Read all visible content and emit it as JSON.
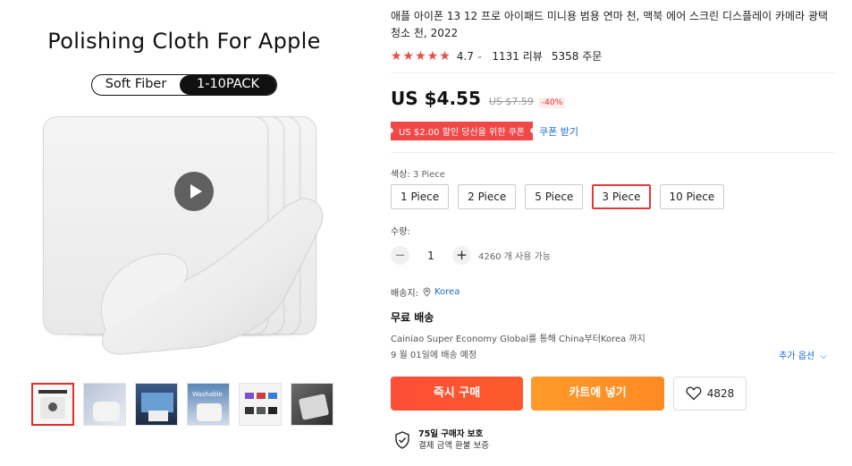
{
  "gallery": {
    "title": "Polishing Cloth For Apple",
    "pill_left": "Soft Fiber",
    "pill_right": "1-10PACK",
    "thumbs": [
      {
        "name": "thumb-1"
      },
      {
        "name": "thumb-2"
      },
      {
        "name": "thumb-3"
      },
      {
        "name": "thumb-4"
      },
      {
        "name": "thumb-5"
      },
      {
        "name": "thumb-6"
      }
    ],
    "thumb_4_text": "Washable"
  },
  "product": {
    "title": "애플 아이폰 13 12 프로 아이패드 미니용 범용 연마 천, 맥북 에어 스크린 디스플레이 카메라 광택 청소 천, 2022",
    "rating": "4.7",
    "rating_count": 5,
    "reviews": "1131 리뷰",
    "orders": "5358 주문",
    "price": "US $4.55",
    "old_price": "US $7.59",
    "discount": "-40%",
    "coupon": "US $2.00 할인 당신을 위한 쿠폰",
    "coupon_link": "쿠폰 받기"
  },
  "color": {
    "label": "색상:",
    "selected": "3 Piece",
    "options": [
      "1 Piece",
      "2 Piece",
      "5 Piece",
      "3 Piece",
      "10 Piece"
    ],
    "selected_index": 3
  },
  "quantity": {
    "label": "수량:",
    "minus": "−",
    "value": "1",
    "plus": "+",
    "available": "4260 개 사용 가능"
  },
  "shipping": {
    "to_label": "배송지:",
    "country": "Korea",
    "free": "무료 배송",
    "carrier": "Cainiao Super Economy Global를 통해 China부터Korea 까지",
    "eta": "9 월 01일에 배송 예정",
    "more": "추가 옵션"
  },
  "actions": {
    "buy": "즉시 구매",
    "cart": "카트에 넣기",
    "wish_count": "4828"
  },
  "protection": {
    "line1": "75일 구매자 보호",
    "line2": "결제 금액 환불 보증"
  },
  "colors": {
    "accent": "#e62e24",
    "star": "#ea4a44",
    "link": "#1a6ad2",
    "buy": "#fb4a33",
    "cart": "#ff922a"
  }
}
